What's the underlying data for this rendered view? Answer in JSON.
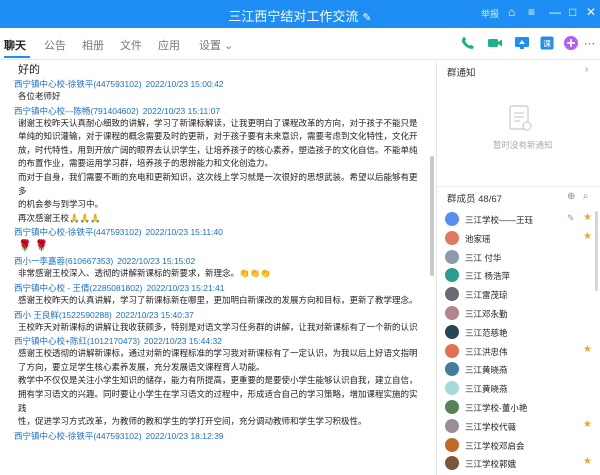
{
  "window": {
    "title": "三江西宁结对工作交流",
    "edit_icon": "edit-icon",
    "report_label": "举报"
  },
  "tabs": [
    "聊天",
    "公告",
    "相册",
    "文件",
    "应用",
    "设置"
  ],
  "toolbar_icons": [
    "phone-icon",
    "video-icon",
    "screen-share-icon",
    "homework-icon",
    "add-icon"
  ],
  "chat": {
    "first_line": "好的",
    "messages": [
      {
        "sender": "西宁镇中心校-徐铁平(447593102)",
        "time": "2022/10/23 15:00:42",
        "lines": [
          "各位老师好"
        ]
      },
      {
        "sender": "西宁镇中心校---陈畅(791404602)",
        "time": "2022/10/23 15:11:07",
        "lines": [
          "谢谢王校昨天认真耐心细致的讲解，学习了新课标解读，让我更明白了课程改革的方向，对于孩子不能只是",
          "单纯的知识灌输，对于课程的概念需要及时的更新，对于孩子要有未来意识，需要考虑到文化特性，文化开",
          "放，时代特性，用到开放广阔的眼界去认识学生，让培养孩子的核心素养，塑造孩子的文化自信。不能单纯",
          "的布置作业，需要运用学习群，培养孩子的思辨能力和文化创造力。",
          "而对于自身，我们需要不断的充电和更新知识，这次线上学习就是一次很好的思想武装。希望以后能够有更多",
          "的机会参与到学习中。",
          "再次感谢王校🙏🙏🙏"
        ]
      },
      {
        "sender": "西宁镇中心校-徐铁平(447593102)",
        "time": "2022/10/23 15:11:40",
        "emoji": "🌹 🌹"
      },
      {
        "sender": "西小一李嘉蓉(610667353)",
        "time": "2022/10/23 15:15:02",
        "lines": [
          "非常感谢王校深入、透彻的讲解新课标的新要求，新理念。👏👏👏"
        ]
      },
      {
        "sender": "西宁镇中心校 - 王倩(2285081802)",
        "time": "2022/10/23 15:21:41",
        "lines": [
          "感谢王校昨天的认真讲解，学习了新课标新在哪里，更加明白新课改的发展方向和目标，更新了教学理念。"
        ]
      },
      {
        "sender": "西小 王良鲜(1522590288)",
        "time": "2022/10/23 15:40:37",
        "lines": [
          "王校昨天对新课标的讲解让我收获颇多，特别是对语文学习任务群的讲解，让我对新课标有了一个新的认识"
        ]
      },
      {
        "sender": "西宁镇中心校+陈红(1012170473)",
        "time": "2022/10/23 15:44:32",
        "lines": [
          "感谢王校透彻的讲解新课标，通过对新的课程标准的学习我对新课标有了一定认识，为我以后上好语文指明",
          "了方向，要立足学生核心素养发展，充分发展语文课程育人功能。",
          "教学中不仅仅是关注小学生知识的储存，能力有所提高，更重要的是要使小学生能够认识自我，建立自信，",
          "拥有学习语文的兴趣。同时要让小学生在学习语文的过程中，形成适合自己的学习策略，增加课程实施的实践",
          "性，促进学习方式改革，为教师的教和学生的学打开空间，充分调动教师和学生学习积极性。"
        ]
      },
      {
        "sender": "西宁镇中心校-徐铁平(447593102)",
        "time": "2022/10/23 18:12:39",
        "lines": []
      }
    ]
  },
  "side": {
    "notice_title": "群通知",
    "notice_empty": "暂时没有新通知",
    "members_title": "群成员 48/67",
    "members": [
      {
        "name": "三江学校——王珏",
        "color": "#5b8def",
        "badge": "edit"
      },
      {
        "name": "池家瑶",
        "color": "#e07a5f",
        "badge": "star"
      },
      {
        "name": "三江  付华",
        "color": "#8d99ae",
        "badge": ""
      },
      {
        "name": "三江  杨浩萍",
        "color": "#2a9d8f",
        "badge": ""
      },
      {
        "name": "三江雷茂琼",
        "color": "#6d6875",
        "badge": ""
      },
      {
        "name": "三江邓永勤",
        "color": "#b5838d",
        "badge": ""
      },
      {
        "name": "三江范慈艳",
        "color": "#264653",
        "badge": ""
      },
      {
        "name": "三江洪忠伟",
        "color": "#e76f51",
        "badge": "star"
      },
      {
        "name": "三江黄晓燕",
        "color": "#457b9d",
        "badge": ""
      },
      {
        "name": "三江黄晓燕",
        "color": "#a8dadc",
        "badge": ""
      },
      {
        "name": "三江学校-董小艳",
        "color": "#588157",
        "badge": ""
      },
      {
        "name": "三江学校代薇",
        "color": "#9a8c98",
        "badge": "star"
      },
      {
        "name": "三江学校邓启会",
        "color": "#bc6c25",
        "badge": ""
      },
      {
        "name": "三江学校郭娥",
        "color": "#7f5539",
        "badge": "star"
      }
    ]
  }
}
